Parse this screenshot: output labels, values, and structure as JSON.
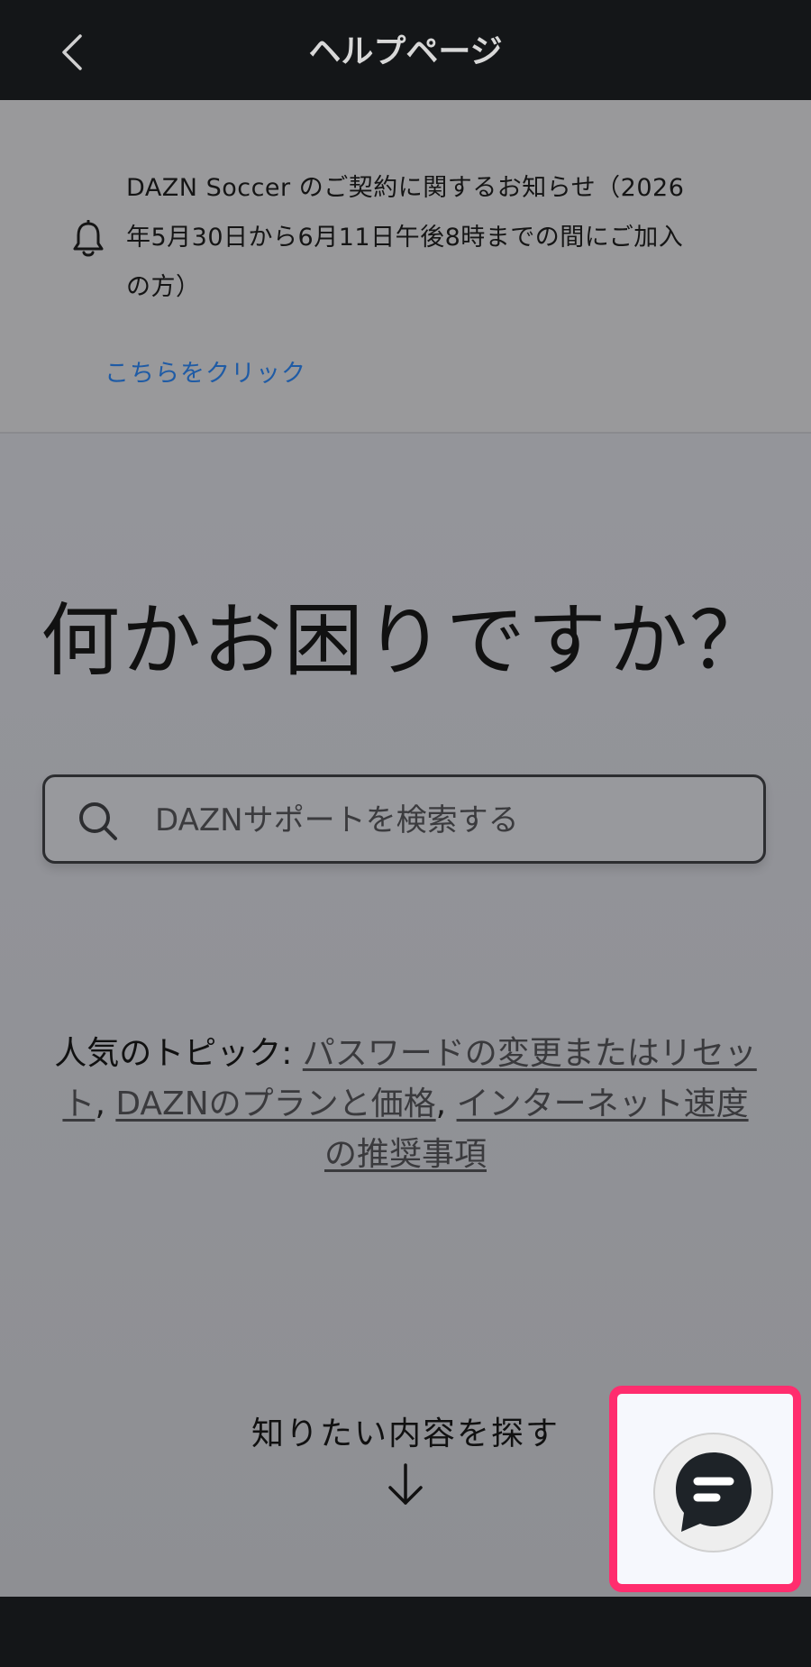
{
  "header": {
    "title": "ヘルプページ",
    "back_icon": "chevron-left-icon"
  },
  "notice": {
    "icon": "bell-icon",
    "message": "DAZN Soccer のご契約に関するお知らせ（2026年5月30日から6月11日午後8時までの間にご加入の方）",
    "link_label": "こちらをクリック"
  },
  "hero": {
    "title": "何かお困りですか？"
  },
  "search": {
    "icon": "search-icon",
    "placeholder": "DAZNサポートを検索する"
  },
  "topics": {
    "label": "人気のトピック:",
    "items": [
      "パスワードの変更またはリセット",
      "DAZNのプランと価格",
      "インターネット速度の推奨事項"
    ],
    "separator": ","
  },
  "explore": {
    "label": "知りたい内容を探す",
    "icon": "arrow-down-icon"
  },
  "chat": {
    "icon": "chat-bubble-icon",
    "highlight_color": "#ff2d6e"
  },
  "colors": {
    "link": "#1f5ba5",
    "bar": "#141618"
  }
}
